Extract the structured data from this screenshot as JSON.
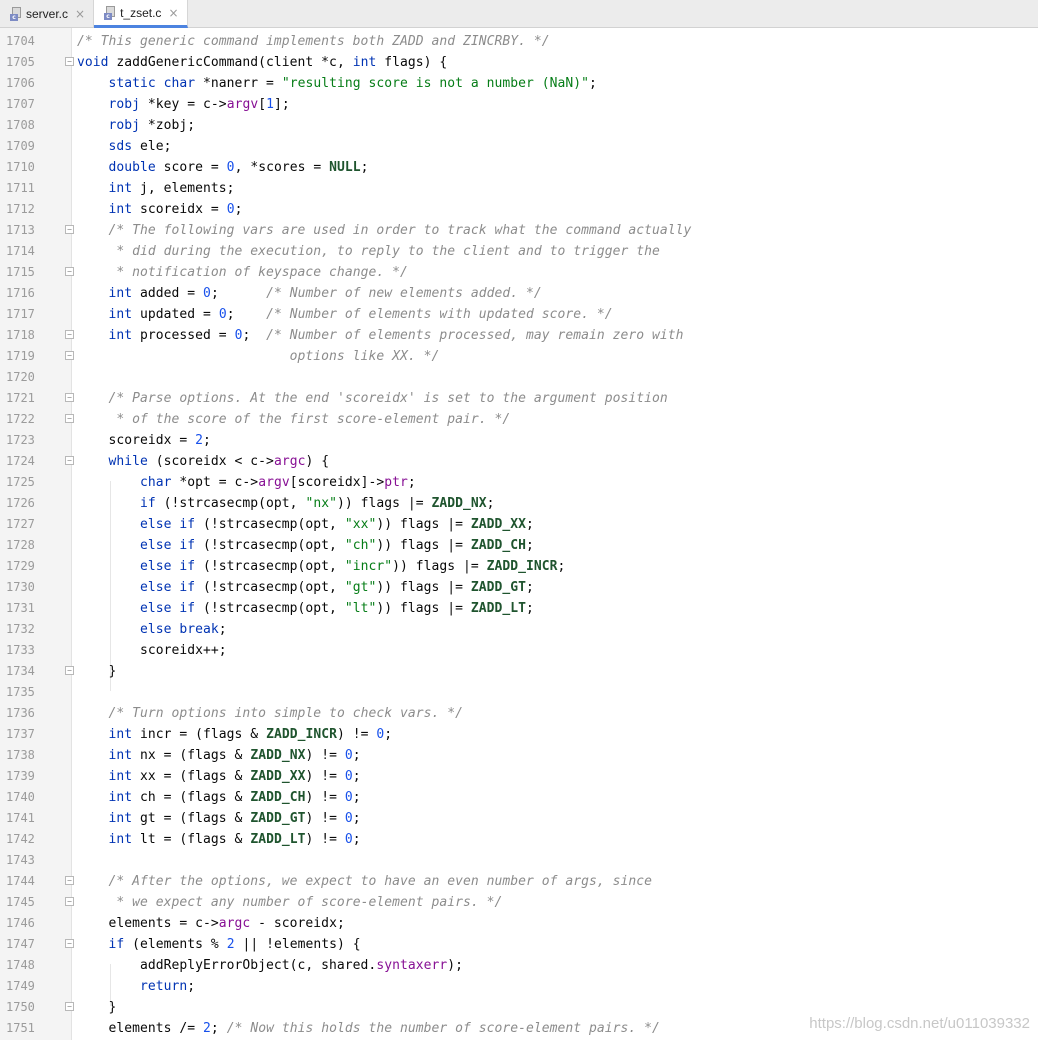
{
  "tabs": [
    {
      "label": "server.c",
      "icon": "c-file-icon",
      "active": false
    },
    {
      "label": "t_zset.c",
      "icon": "c-file-icon",
      "active": true
    }
  ],
  "colors": {
    "keyword": "#0033b3",
    "comment": "#8c8c8c",
    "string": "#067d17",
    "number": "#1750eb",
    "macro": "#1f542e",
    "field": "#871094",
    "tab_active_underline": "#4c83e0"
  },
  "watermark": "https://blog.csdn.net/u011039332",
  "lines": [
    {
      "n": "1704",
      "fold": false,
      "tokens": [
        [
          "cm",
          "/* This generic command implements both ZADD and ZINCRBY. */"
        ]
      ]
    },
    {
      "n": "1705",
      "fold": true,
      "tokens": [
        [
          "kw",
          "void"
        ],
        [
          "",
          " zaddGenericCommand(client *c, "
        ],
        [
          "kw",
          "int"
        ],
        [
          "",
          " flags) {"
        ]
      ]
    },
    {
      "n": "1706",
      "fold": false,
      "tokens": [
        [
          "",
          "    "
        ],
        [
          "kw",
          "static char"
        ],
        [
          "",
          " *nanerr = "
        ],
        [
          "str",
          "\"resulting score is not a number (NaN)\""
        ],
        [
          "",
          ";"
        ]
      ]
    },
    {
      "n": "1707",
      "fold": false,
      "tokens": [
        [
          "",
          "    "
        ],
        [
          "kw",
          "robj"
        ],
        [
          "",
          " *key = c->"
        ],
        [
          "fld",
          "argv"
        ],
        [
          "",
          "["
        ],
        [
          "num",
          "1"
        ],
        [
          "",
          "];"
        ]
      ]
    },
    {
      "n": "1708",
      "fold": false,
      "tokens": [
        [
          "",
          "    "
        ],
        [
          "kw",
          "robj"
        ],
        [
          "",
          " *zobj;"
        ]
      ]
    },
    {
      "n": "1709",
      "fold": false,
      "tokens": [
        [
          "",
          "    "
        ],
        [
          "kw",
          "sds"
        ],
        [
          "",
          " ele;"
        ]
      ]
    },
    {
      "n": "1710",
      "fold": false,
      "tokens": [
        [
          "",
          "    "
        ],
        [
          "kw",
          "double"
        ],
        [
          "",
          " score = "
        ],
        [
          "num",
          "0"
        ],
        [
          "",
          ", *scores = "
        ],
        [
          "mac",
          "NULL"
        ],
        [
          "",
          ";"
        ]
      ]
    },
    {
      "n": "1711",
      "fold": false,
      "tokens": [
        [
          "",
          "    "
        ],
        [
          "kw",
          "int"
        ],
        [
          "",
          " j, elements;"
        ]
      ]
    },
    {
      "n": "1712",
      "fold": false,
      "tokens": [
        [
          "",
          "    "
        ],
        [
          "kw",
          "int"
        ],
        [
          "",
          " scoreidx = "
        ],
        [
          "num",
          "0"
        ],
        [
          "",
          ";"
        ]
      ]
    },
    {
      "n": "1713",
      "fold": true,
      "tokens": [
        [
          "",
          "    "
        ],
        [
          "cm",
          "/* The following vars are used in order to track what the command actually"
        ]
      ]
    },
    {
      "n": "1714",
      "fold": false,
      "tokens": [
        [
          "",
          "     "
        ],
        [
          "cm",
          "* did during the execution, to reply to the client and to trigger the"
        ]
      ]
    },
    {
      "n": "1715",
      "fold": true,
      "tokens": [
        [
          "",
          "     "
        ],
        [
          "cm",
          "* notification of keyspace change. */"
        ]
      ]
    },
    {
      "n": "1716",
      "fold": false,
      "tokens": [
        [
          "",
          "    "
        ],
        [
          "kw",
          "int"
        ],
        [
          "",
          " added = "
        ],
        [
          "num",
          "0"
        ],
        [
          "",
          ";      "
        ],
        [
          "cm",
          "/* Number of new elements added. */"
        ]
      ]
    },
    {
      "n": "1717",
      "fold": false,
      "tokens": [
        [
          "",
          "    "
        ],
        [
          "kw",
          "int"
        ],
        [
          "",
          " updated = "
        ],
        [
          "num",
          "0"
        ],
        [
          "",
          ";    "
        ],
        [
          "cm",
          "/* Number of elements with updated score. */"
        ]
      ]
    },
    {
      "n": "1718",
      "fold": true,
      "tokens": [
        [
          "",
          "    "
        ],
        [
          "kw",
          "int"
        ],
        [
          "",
          " processed = "
        ],
        [
          "num",
          "0"
        ],
        [
          "",
          ";  "
        ],
        [
          "cm",
          "/* Number of elements processed, may remain zero with"
        ]
      ]
    },
    {
      "n": "1719",
      "fold": true,
      "tokens": [
        [
          "",
          "                           "
        ],
        [
          "cm",
          "options like XX. */"
        ]
      ]
    },
    {
      "n": "1720",
      "fold": false,
      "tokens": [
        [
          "",
          ""
        ]
      ]
    },
    {
      "n": "1721",
      "fold": true,
      "tokens": [
        [
          "",
          "    "
        ],
        [
          "cm",
          "/* Parse options. At the end 'scoreidx' is set to the argument position"
        ]
      ]
    },
    {
      "n": "1722",
      "fold": true,
      "tokens": [
        [
          "",
          "     "
        ],
        [
          "cm",
          "* of the score of the first score-element pair. */"
        ]
      ]
    },
    {
      "n": "1723",
      "fold": false,
      "tokens": [
        [
          "",
          "    scoreidx = "
        ],
        [
          "num",
          "2"
        ],
        [
          "",
          ";"
        ]
      ]
    },
    {
      "n": "1724",
      "fold": true,
      "tokens": [
        [
          "",
          "    "
        ],
        [
          "kw",
          "while"
        ],
        [
          "",
          " (scoreidx < c->"
        ],
        [
          "fld",
          "argc"
        ],
        [
          "",
          ") {"
        ]
      ]
    },
    {
      "n": "1725",
      "fold": false,
      "tokens": [
        [
          "",
          "        "
        ],
        [
          "kw",
          "char"
        ],
        [
          "",
          " *opt = c->"
        ],
        [
          "fld",
          "argv"
        ],
        [
          "",
          "[scoreidx]->"
        ],
        [
          "fld",
          "ptr"
        ],
        [
          "",
          ";"
        ]
      ]
    },
    {
      "n": "1726",
      "fold": false,
      "tokens": [
        [
          "",
          "        "
        ],
        [
          "kw",
          "if"
        ],
        [
          "",
          " (!strcasecmp(opt, "
        ],
        [
          "str",
          "\"nx\""
        ],
        [
          "",
          ")) flags |= "
        ],
        [
          "mac",
          "ZADD_NX"
        ],
        [
          "",
          ";"
        ]
      ]
    },
    {
      "n": "1727",
      "fold": false,
      "tokens": [
        [
          "",
          "        "
        ],
        [
          "kw",
          "else if"
        ],
        [
          "",
          " (!strcasecmp(opt, "
        ],
        [
          "str",
          "\"xx\""
        ],
        [
          "",
          ")) flags |= "
        ],
        [
          "mac",
          "ZADD_XX"
        ],
        [
          "",
          ";"
        ]
      ]
    },
    {
      "n": "1728",
      "fold": false,
      "tokens": [
        [
          "",
          "        "
        ],
        [
          "kw",
          "else if"
        ],
        [
          "",
          " (!strcasecmp(opt, "
        ],
        [
          "str",
          "\"ch\""
        ],
        [
          "",
          ")) flags |= "
        ],
        [
          "mac",
          "ZADD_CH"
        ],
        [
          "",
          ";"
        ]
      ]
    },
    {
      "n": "1729",
      "fold": false,
      "tokens": [
        [
          "",
          "        "
        ],
        [
          "kw",
          "else if"
        ],
        [
          "",
          " (!strcasecmp(opt, "
        ],
        [
          "str",
          "\"incr\""
        ],
        [
          "",
          ")) flags |= "
        ],
        [
          "mac",
          "ZADD_INCR"
        ],
        [
          "",
          ";"
        ]
      ]
    },
    {
      "n": "1730",
      "fold": false,
      "tokens": [
        [
          "",
          "        "
        ],
        [
          "kw",
          "else if"
        ],
        [
          "",
          " (!strcasecmp(opt, "
        ],
        [
          "str",
          "\"gt\""
        ],
        [
          "",
          ")) flags |= "
        ],
        [
          "mac",
          "ZADD_GT"
        ],
        [
          "",
          ";"
        ]
      ]
    },
    {
      "n": "1731",
      "fold": false,
      "tokens": [
        [
          "",
          "        "
        ],
        [
          "kw",
          "else if"
        ],
        [
          "",
          " (!strcasecmp(opt, "
        ],
        [
          "str",
          "\"lt\""
        ],
        [
          "",
          ")) flags |= "
        ],
        [
          "mac",
          "ZADD_LT"
        ],
        [
          "",
          ";"
        ]
      ]
    },
    {
      "n": "1732",
      "fold": false,
      "tokens": [
        [
          "",
          "        "
        ],
        [
          "kw",
          "else break"
        ],
        [
          "",
          ";"
        ]
      ]
    },
    {
      "n": "1733",
      "fold": false,
      "tokens": [
        [
          "",
          "        scoreidx++;"
        ]
      ]
    },
    {
      "n": "1734",
      "fold": true,
      "tokens": [
        [
          "",
          "    }"
        ]
      ]
    },
    {
      "n": "1735",
      "fold": false,
      "tokens": [
        [
          "",
          ""
        ]
      ]
    },
    {
      "n": "1736",
      "fold": false,
      "tokens": [
        [
          "",
          "    "
        ],
        [
          "cm",
          "/* Turn options into simple to check vars. */"
        ]
      ]
    },
    {
      "n": "1737",
      "fold": false,
      "tokens": [
        [
          "",
          "    "
        ],
        [
          "kw",
          "int"
        ],
        [
          "",
          " incr = (flags & "
        ],
        [
          "mac",
          "ZADD_INCR"
        ],
        [
          "",
          ") != "
        ],
        [
          "num",
          "0"
        ],
        [
          "",
          ";"
        ]
      ]
    },
    {
      "n": "1738",
      "fold": false,
      "tokens": [
        [
          "",
          "    "
        ],
        [
          "kw",
          "int"
        ],
        [
          "",
          " nx = (flags & "
        ],
        [
          "mac",
          "ZADD_NX"
        ],
        [
          "",
          ") != "
        ],
        [
          "num",
          "0"
        ],
        [
          "",
          ";"
        ]
      ]
    },
    {
      "n": "1739",
      "fold": false,
      "tokens": [
        [
          "",
          "    "
        ],
        [
          "kw",
          "int"
        ],
        [
          "",
          " xx = (flags & "
        ],
        [
          "mac",
          "ZADD_XX"
        ],
        [
          "",
          ") != "
        ],
        [
          "num",
          "0"
        ],
        [
          "",
          ";"
        ]
      ]
    },
    {
      "n": "1740",
      "fold": false,
      "tokens": [
        [
          "",
          "    "
        ],
        [
          "kw",
          "int"
        ],
        [
          "",
          " ch = (flags & "
        ],
        [
          "mac",
          "ZADD_CH"
        ],
        [
          "",
          ") != "
        ],
        [
          "num",
          "0"
        ],
        [
          "",
          ";"
        ]
      ]
    },
    {
      "n": "1741",
      "fold": false,
      "tokens": [
        [
          "",
          "    "
        ],
        [
          "kw",
          "int"
        ],
        [
          "",
          " gt = (flags & "
        ],
        [
          "mac",
          "ZADD_GT"
        ],
        [
          "",
          ") != "
        ],
        [
          "num",
          "0"
        ],
        [
          "",
          ";"
        ]
      ]
    },
    {
      "n": "1742",
      "fold": false,
      "tokens": [
        [
          "",
          "    "
        ],
        [
          "kw",
          "int"
        ],
        [
          "",
          " lt = (flags & "
        ],
        [
          "mac",
          "ZADD_LT"
        ],
        [
          "",
          ") != "
        ],
        [
          "num",
          "0"
        ],
        [
          "",
          ";"
        ]
      ]
    },
    {
      "n": "1743",
      "fold": false,
      "tokens": [
        [
          "",
          ""
        ]
      ]
    },
    {
      "n": "1744",
      "fold": true,
      "tokens": [
        [
          "",
          "    "
        ],
        [
          "cm",
          "/* After the options, we expect to have an even number of args, since"
        ]
      ]
    },
    {
      "n": "1745",
      "fold": true,
      "tokens": [
        [
          "",
          "     "
        ],
        [
          "cm",
          "* we expect any number of score-element pairs. */"
        ]
      ]
    },
    {
      "n": "1746",
      "fold": false,
      "tokens": [
        [
          "",
          "    elements = c->"
        ],
        [
          "fld",
          "argc"
        ],
        [
          "",
          " - scoreidx;"
        ]
      ]
    },
    {
      "n": "1747",
      "fold": true,
      "tokens": [
        [
          "",
          "    "
        ],
        [
          "kw",
          "if"
        ],
        [
          "",
          " (elements % "
        ],
        [
          "num",
          "2"
        ],
        [
          "",
          " || !elements) {"
        ]
      ]
    },
    {
      "n": "1748",
      "fold": false,
      "tokens": [
        [
          "",
          "        addReplyErrorObject(c, shared."
        ],
        [
          "fld",
          "syntaxerr"
        ],
        [
          "",
          ");"
        ]
      ]
    },
    {
      "n": "1749",
      "fold": false,
      "tokens": [
        [
          "",
          "        "
        ],
        [
          "kw",
          "return"
        ],
        [
          "",
          ";"
        ]
      ]
    },
    {
      "n": "1750",
      "fold": true,
      "tokens": [
        [
          "",
          "    }"
        ]
      ]
    },
    {
      "n": "1751",
      "fold": false,
      "tokens": [
        [
          "",
          "    elements /= "
        ],
        [
          "num",
          "2"
        ],
        [
          "",
          "; "
        ],
        [
          "cm",
          "/* Now this holds the number of score-element pairs. */"
        ]
      ]
    }
  ]
}
